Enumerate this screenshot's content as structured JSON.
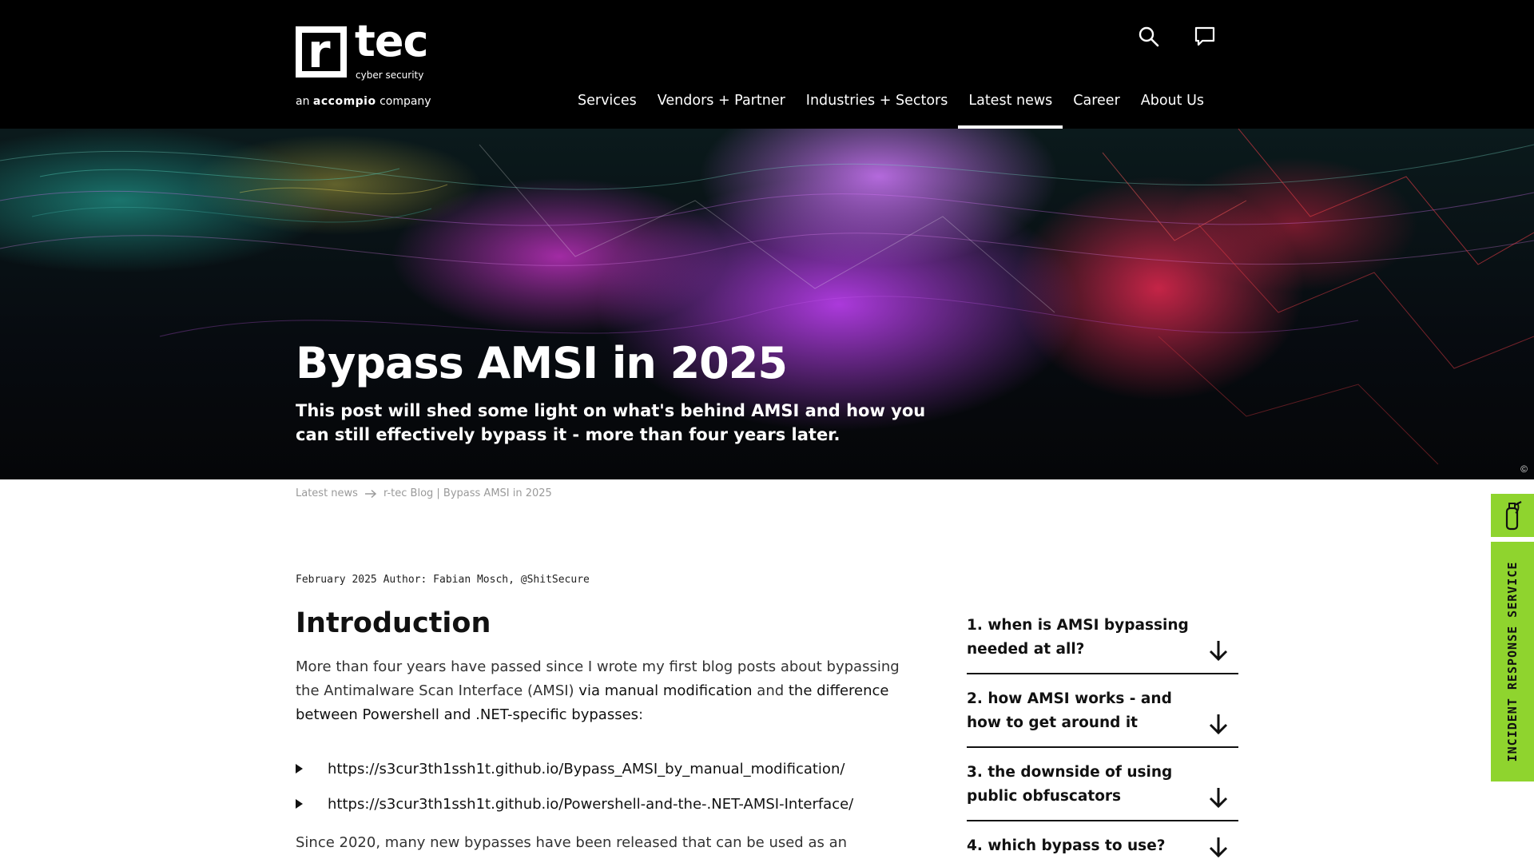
{
  "brand": {
    "logo_mark": "r",
    "logo_name": "tec",
    "logo_sub": "cyber security",
    "tag_prefix": "an",
    "tag_brand": "accompio",
    "tag_suffix": "company"
  },
  "nav": {
    "items": [
      {
        "label": "Services"
      },
      {
        "label": "Vendors + Partner"
      },
      {
        "label": "Industries + Sectors"
      },
      {
        "label": "Latest news",
        "active": true
      },
      {
        "label": "Career"
      },
      {
        "label": "About Us"
      }
    ]
  },
  "header_icons": [
    "search-icon",
    "chat-icon"
  ],
  "hero": {
    "title": "Bypass AMSI in 2025",
    "subtitle": "This post will shed some light on what's behind AMSI and how you can still effectively bypass it - more than four years later.",
    "copyright": "©"
  },
  "breadcrumb": {
    "parent": "Latest news",
    "current": "r-tec Blog | Bypass AMSI in 2025"
  },
  "article": {
    "meta": "February 2025 Author: Fabian Mosch, @ShitSecure",
    "heading": "Introduction",
    "para1_a": "More than four years have passed since I wrote my first blog posts about bypassing the Antimalware Scan Interface (AMSI) ",
    "para1_link1": "via manual modification",
    "para1_b": " and ",
    "para1_link2": "the difference between Powershell and .NET-specific bypasses",
    "para1_c": ":",
    "links": [
      "https://s3cur3th1ssh1t.github.io/Bypass_AMSI_by_manual_modification/",
      "https://s3cur3th1ssh1t.github.io/Powershell-and-the-.NET-AMSI-Interface/"
    ],
    "para2": "Since 2020, many new bypasses have been released that can be used as an"
  },
  "toc": {
    "items": [
      "1. when is AMSI bypassing needed at all?",
      "2. how AMSI works - and how to get around it",
      "3. the downside of using public obfuscators",
      "4. which bypass to use?"
    ]
  },
  "side_tab": {
    "label": "INCIDENT RESPONSE SERVICE",
    "icon": "fire-extinguisher-icon"
  },
  "colors": {
    "header_bg": "#000000",
    "accent_green": "#8fd42e"
  }
}
